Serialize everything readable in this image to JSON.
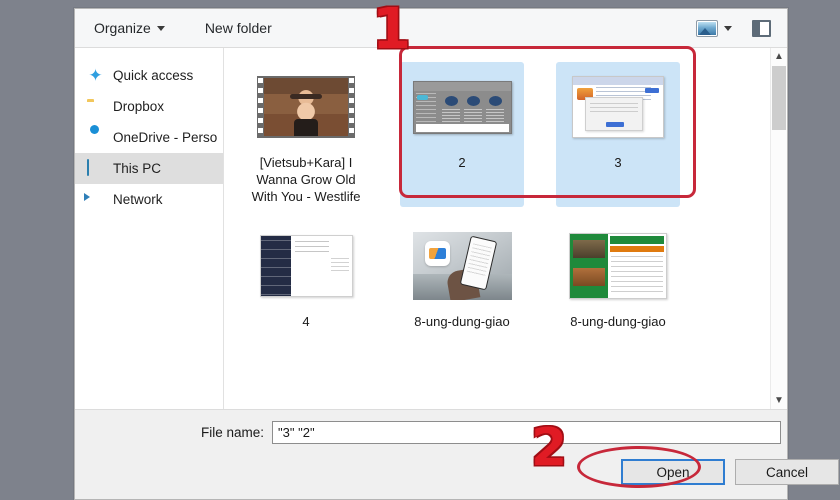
{
  "window": {
    "type": "file-open-dialog"
  },
  "toolbar": {
    "organize_label": "Organize",
    "new_folder_label": "New folder",
    "view_icon": "view-layout-icon",
    "view_caret": "chevron-down-icon",
    "preview_pane_icon": "preview-pane-icon"
  },
  "sidebar": {
    "items": [
      {
        "label": "Quick access",
        "icon": "star-icon",
        "selected": false
      },
      {
        "label": "Dropbox",
        "icon": "folder-icon",
        "selected": false
      },
      {
        "label": "OneDrive - Perso",
        "icon": "cloud-icon",
        "selected": false
      },
      {
        "label": "This PC",
        "icon": "computer-icon",
        "selected": true
      },
      {
        "label": "Network",
        "icon": "network-icon",
        "selected": false
      }
    ]
  },
  "files": [
    {
      "label": "[Vietsub+Kara] I Wanna Grow Old With You - Westlife",
      "thumb": "video-film-thumbnail",
      "selected": false
    },
    {
      "label": "2",
      "thumb": "window-screenshot-thumbnail",
      "selected": true
    },
    {
      "label": "3",
      "thumb": "dialog-screenshot-thumbnail",
      "selected": true
    },
    {
      "label": "4",
      "thumb": "dark-sidebar-screenshot-thumbnail",
      "selected": false
    },
    {
      "label": "8-ung-dung-giao",
      "thumb": "phone-in-hand-photo-thumbnail",
      "selected": false
    },
    {
      "label": "8-ung-dung-giao",
      "thumb": "green-app-screenshot-thumbnail",
      "selected": false
    }
  ],
  "scrollbar": {
    "up_arrow": "chevron-up-icon",
    "down_arrow": "chevron-down-icon"
  },
  "footer": {
    "file_name_label": "File name:",
    "file_name_value": "\"3\" \"2\"",
    "file_name_placeholder": "File name",
    "open_label": "Open",
    "cancel_label": "Cancel"
  },
  "annotations": {
    "step_one": "1",
    "step_two": "2",
    "color": "#c7283a"
  }
}
